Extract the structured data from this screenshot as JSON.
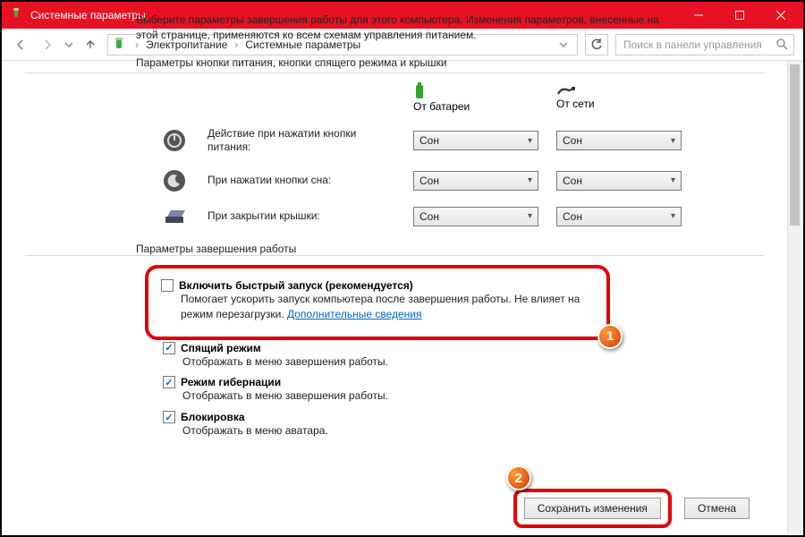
{
  "window": {
    "title": "Системные параметры"
  },
  "breadcrumb": {
    "level1": "Электропитание",
    "level2": "Системные параметры"
  },
  "search": {
    "placeholder": "Поиск в панели управления"
  },
  "intro": "Выберите параметры завершения работы для этого компьютера. Изменения параметров, внесенные на этой странице, применяются ко всем схемам управления питанием.",
  "section_buttons_title": "Параметры кнопки питания, кнопки спящего режима и крышки",
  "cols": {
    "battery": "От батареи",
    "ac": "От сети"
  },
  "rows": {
    "power": {
      "label": "Действие при нажатии кнопки питания:",
      "battery": "Сон",
      "ac": "Сон"
    },
    "sleep": {
      "label": "При нажатии кнопки сна:",
      "battery": "Сон",
      "ac": "Сон"
    },
    "lid": {
      "label": "При закрытии крышки:",
      "battery": "Сон",
      "ac": "Сон"
    }
  },
  "shutdown_title": "Параметры завершения работы",
  "fastboot": {
    "label": "Включить быстрый запуск (рекомендуется)",
    "desc_pre": "Помогает ускорить запуск компьютера после завершения работы. Не влияет на режим перезагрузки. ",
    "link": "Дополнительные сведения"
  },
  "opts": {
    "sleep": {
      "label": "Спящий режим",
      "desc": "Отображать в меню завершения работы."
    },
    "hib": {
      "label": "Режим гибернации",
      "desc": "Отображать в меню завершения работы."
    },
    "lock": {
      "label": "Блокировка",
      "desc": "Отображать в меню аватара."
    }
  },
  "buttons": {
    "save": "Сохранить изменения",
    "cancel": "Отмена"
  },
  "callouts": {
    "one": "1",
    "two": "2"
  }
}
